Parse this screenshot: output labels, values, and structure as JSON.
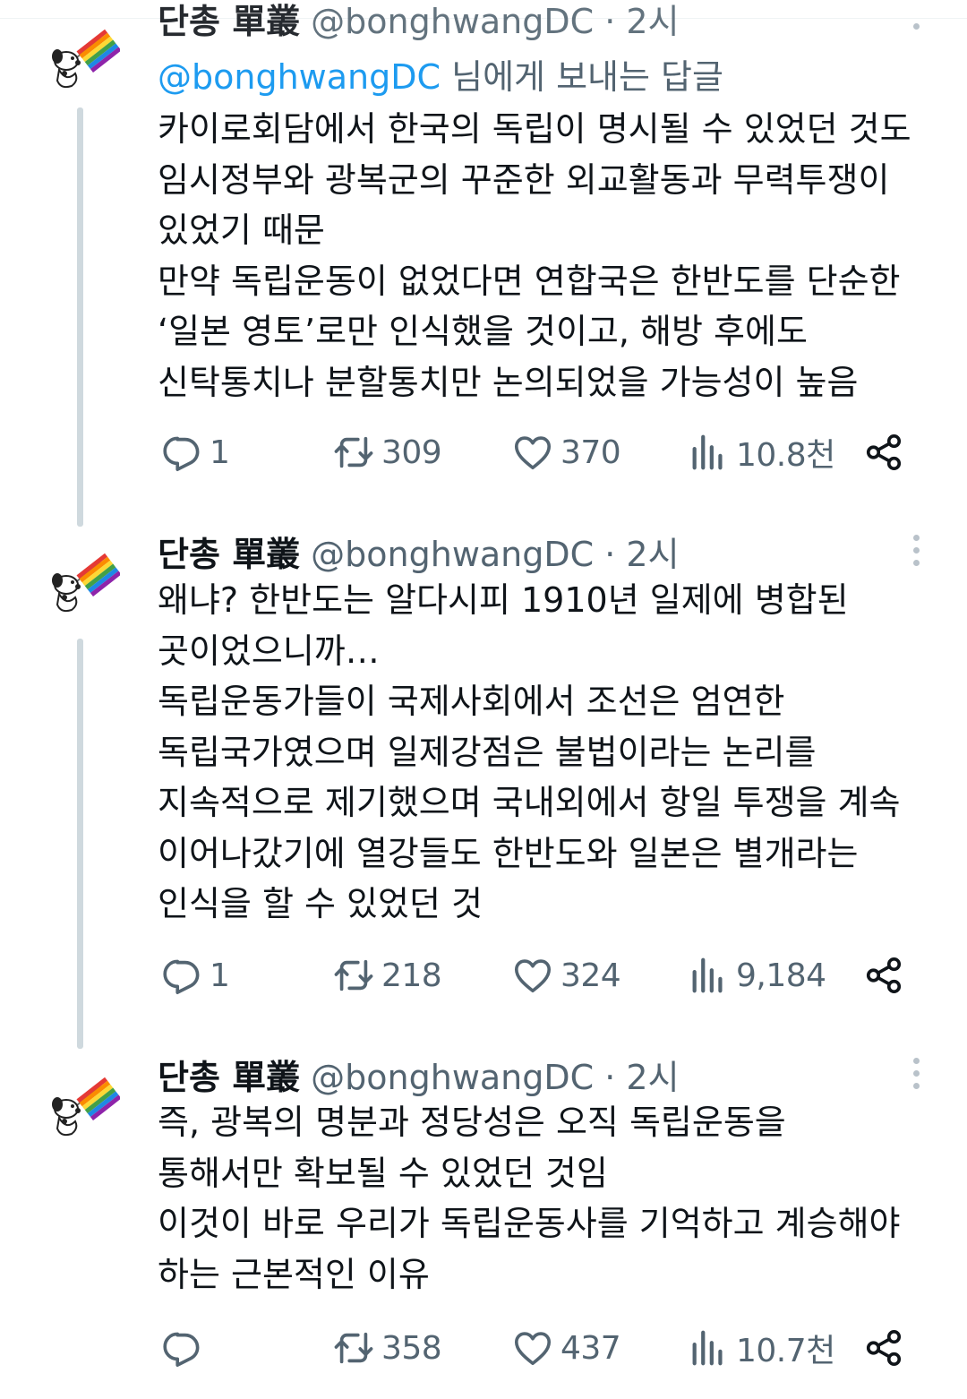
{
  "tweets": [
    {
      "display_name": "단총 單叢",
      "handle_time": "@bonghwangDC · 2시",
      "replying_prefix": "@bonghwangDC",
      "replying_suffix": " 님에게 보내는 답글",
      "text": "카이로회담에서 한국의 독립이 명시될 수 있었던 것도\n임시정부와 광복군의 꾸준한 외교활동과 무력투쟁이\n있었기 때문\n만약 독립운동이 없었다면 연합국은 한반도를 단순한\n‘일본 영토’로만 인식했을 것이고, 해방 후에도\n신탁통치나 분할통치만 논의되었을 가능성이 높음",
      "replies": "1",
      "retweets": "309",
      "likes": "370",
      "views": "10.8천"
    },
    {
      "display_name": "단총 單叢",
      "handle_time": "@bonghwangDC · 2시",
      "text": "왜냐? 한반도는 알다시피 1910년 일제에 병합된\n곳이었으니까…\n독립운동가들이 국제사회에서 조선은 엄연한\n독립국가였으며 일제강점은 불법이라는 논리를\n지속적으로 제기했으며 국내외에서 항일 투쟁을 계속\n이어나갔기에 열강들도 한반도와 일본은 별개라는\n인식을 할 수 있었던 것",
      "replies": "1",
      "retweets": "218",
      "likes": "324",
      "views": "9,184"
    },
    {
      "display_name": "단총 單叢",
      "handle_time": "@bonghwangDC · 2시",
      "text": "즉, 광복의 명분과 정당성은 오직 독립운동을\n통해서만 확보될 수 있었던 것임\n이것이 바로 우리가 독립운동사를 기억하고 계승해야\n하는 근본적인 이유",
      "replies": "",
      "retweets": "358",
      "likes": "437",
      "views": "10.7천"
    }
  ],
  "icons": {
    "avatar": "snoopy-rainbow-flag-avatar",
    "reply": "reply-icon",
    "retweet": "retweet-icon",
    "like": "heart-icon",
    "views": "views-icon",
    "share": "share-icon",
    "more": "more-icon"
  },
  "colors": {
    "text": "#0f1419",
    "secondary": "#536471",
    "link": "#1d9bf0",
    "thread_line": "#cfd9de"
  }
}
